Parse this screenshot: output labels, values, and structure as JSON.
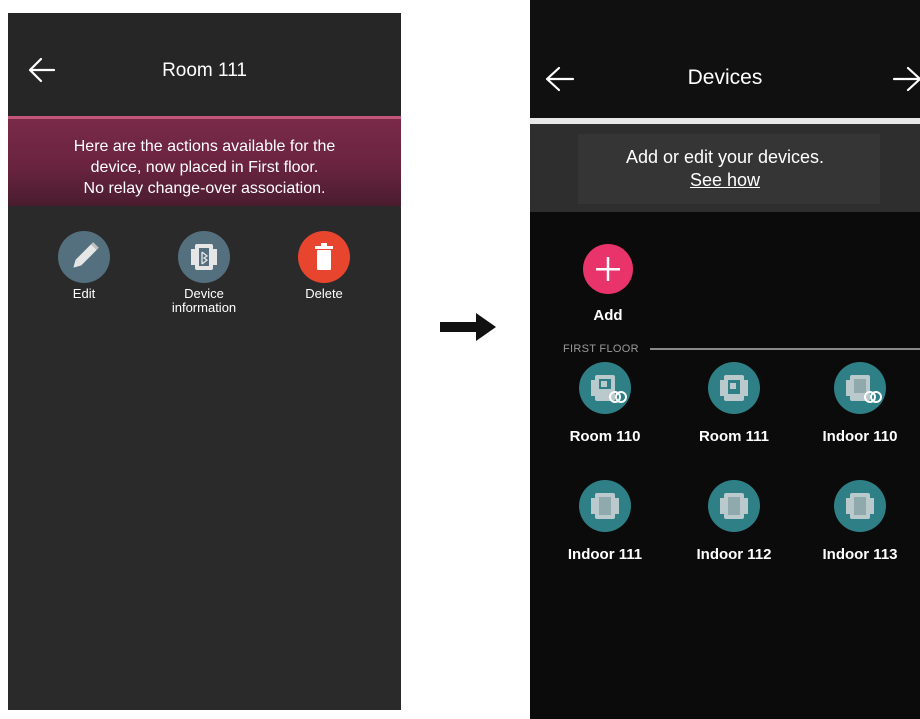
{
  "left_screen": {
    "title": "Room 111",
    "banner": {
      "line1": "Here are the actions available for the",
      "line2": "device, now placed in First floor.",
      "line3": "No relay change-over association."
    },
    "actions": [
      {
        "label_line1": "Edit",
        "label_line2": "",
        "icon": "pencil-icon",
        "color": "#54707f"
      },
      {
        "label_line1": "Device",
        "label_line2": "information",
        "icon": "device-info-icon",
        "color": "#54707f"
      },
      {
        "label_line1": "Delete",
        "label_line2": "",
        "icon": "trash-icon",
        "color": "#e8452e"
      }
    ]
  },
  "right_screen": {
    "title": "Devices",
    "subtitle": "Add or edit your devices.",
    "see_how": "See how",
    "add_label": "Add",
    "section_label": "FIRST FLOOR",
    "devices": [
      {
        "label": "Room 110",
        "icon": "room-device-link-icon"
      },
      {
        "label": "Room 111",
        "icon": "room-device-icon"
      },
      {
        "label": "Indoor 110",
        "icon": "indoor-device-link-icon"
      },
      {
        "label": "Indoor 111",
        "icon": "indoor-device-icon"
      },
      {
        "label": "Indoor 112",
        "icon": "indoor-device-icon"
      },
      {
        "label": "Indoor 113",
        "icon": "indoor-device-icon"
      }
    ]
  },
  "colors": {
    "accent_pink": "#e8336b",
    "device_teal": "#2f7f86",
    "banner_maroon": "#6a2440"
  }
}
